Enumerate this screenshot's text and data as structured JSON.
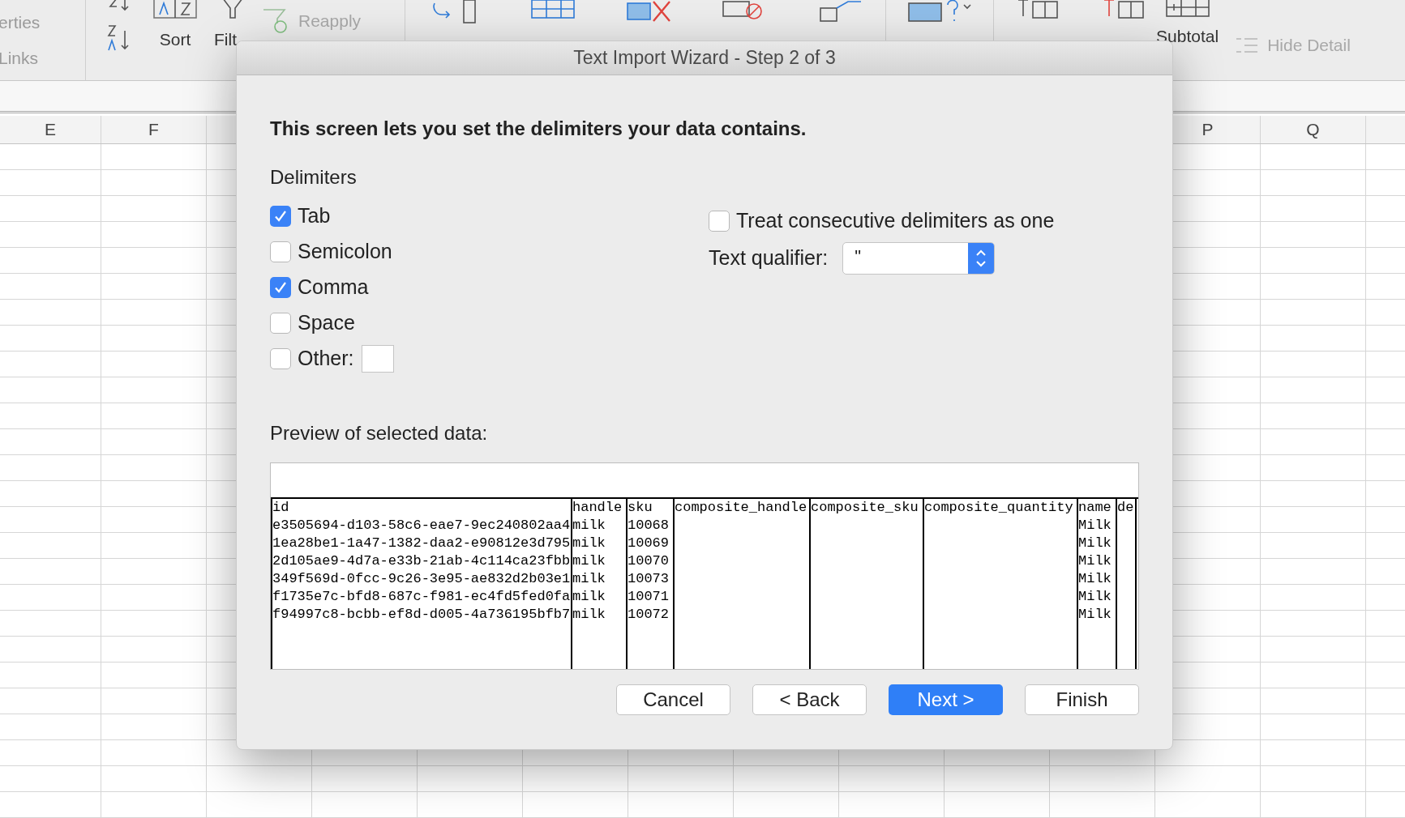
{
  "ribbon": {
    "left_labels": [
      "erties",
      "Links"
    ],
    "sort_label": "Sort",
    "filter_label": "Filt",
    "reapply": {
      "label": "Reapply",
      "disabled": true
    },
    "subtotal_label": "Subtotal",
    "hide_detail": {
      "label": "Hide Detail",
      "disabled": true
    }
  },
  "sheet": {
    "left_columns": [
      "E",
      "F"
    ],
    "right_columns": [
      "P",
      "Q"
    ]
  },
  "dialog": {
    "title": "Text Import Wizard - Step 2 of 3",
    "instruction": "This screen lets you set the delimiters your data contains.",
    "delimiters_label": "Delimiters",
    "delimiters": [
      {
        "label": "Tab",
        "checked": true,
        "kind": "plain"
      },
      {
        "label": "Semicolon",
        "checked": false,
        "kind": "plain"
      },
      {
        "label": "Comma",
        "checked": true,
        "kind": "plain"
      },
      {
        "label": "Space",
        "checked": false,
        "kind": "plain"
      },
      {
        "label": "Other:",
        "checked": false,
        "kind": "with_field"
      }
    ],
    "consecutive": {
      "label": "Treat consecutive delimiters as one",
      "checked": false
    },
    "qualifier": {
      "label": "Text qualifier:",
      "value": "\""
    },
    "preview_label": "Preview of selected data:",
    "preview": {
      "columns": [
        "id",
        "handle",
        "sku",
        "composite_handle",
        "composite_sku",
        "composite_quantity",
        "name",
        "de"
      ],
      "rows": [
        {
          "id": "e3505694-d103-58c6-eae7-9ec240802aa4",
          "handle": "milk",
          "sku": "10068",
          "name": "Milk"
        },
        {
          "id": "1ea28be1-1a47-1382-daa2-e90812e3d795",
          "handle": "milk",
          "sku": "10069",
          "name": "Milk"
        },
        {
          "id": "2d105ae9-4d7a-e33b-21ab-4c114ca23fbb",
          "handle": "milk",
          "sku": "10070",
          "name": "Milk"
        },
        {
          "id": "349f569d-0fcc-9c26-3e95-ae832d2b03e1",
          "handle": "milk",
          "sku": "10073",
          "name": "Milk"
        },
        {
          "id": "f1735e7c-bfd8-687c-f981-ec4fd5fed0fa",
          "handle": "milk",
          "sku": "10071",
          "name": "Milk"
        },
        {
          "id": "f94997c8-bcbb-ef8d-d005-4a736195bfb7",
          "handle": "milk",
          "sku": "10072",
          "name": "Milk"
        }
      ]
    },
    "buttons": [
      {
        "label": "Cancel",
        "default": false
      },
      {
        "label": "< Back",
        "default": false
      },
      {
        "label": "Next >",
        "default": true
      },
      {
        "label": "Finish",
        "default": false
      }
    ]
  }
}
